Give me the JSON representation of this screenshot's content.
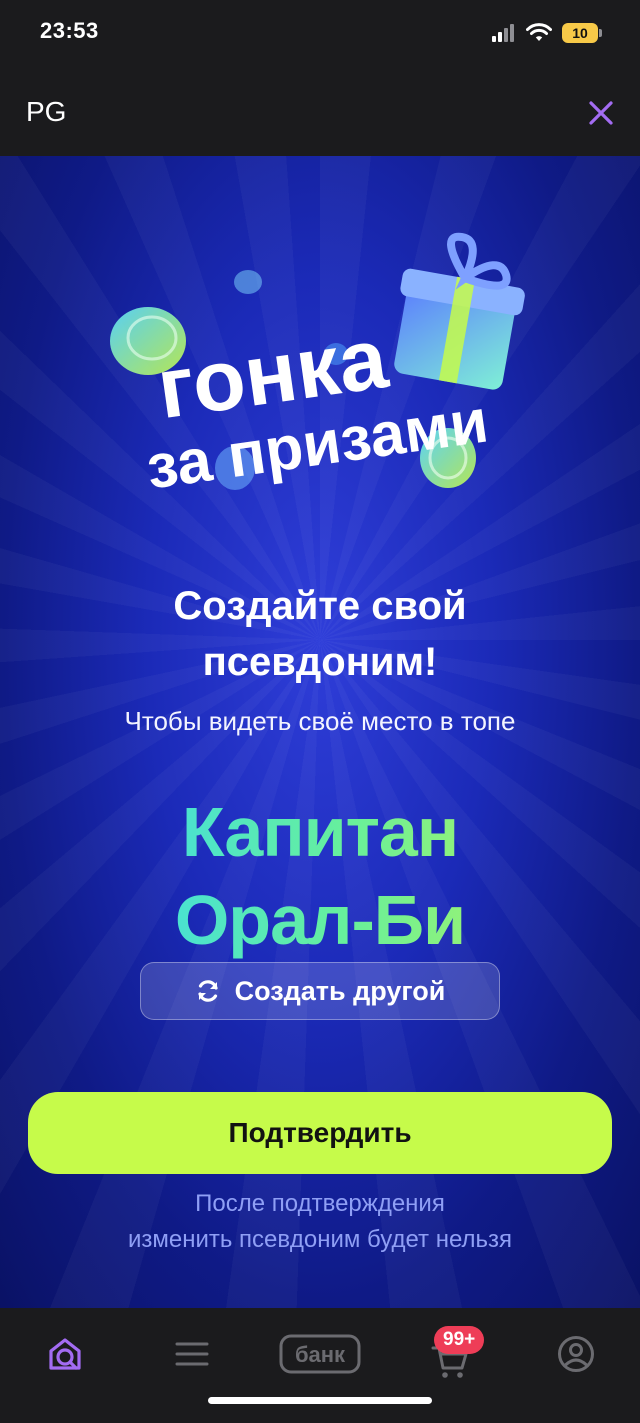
{
  "status_bar": {
    "time": "23:53",
    "battery": "10"
  },
  "header": {
    "title": "PG"
  },
  "banner": {
    "line1": "гонка",
    "line2": "за призами"
  },
  "main": {
    "headline_line1": "Создайте свой",
    "headline_line2": "псевдоним!",
    "subtitle": "Чтобы видеть своё место в топе",
    "nickname_line1": "Капитан",
    "nickname_line2": "Орал-Би",
    "regenerate_label": "Создать другой",
    "confirm_label": "Подтвердить",
    "note_line1": "После подтверждения",
    "note_line2": "изменить псевдоним будет нельзя"
  },
  "bottom_nav": {
    "bank_label": "банк",
    "cart_badge": "99+"
  },
  "colors": {
    "accent_purple": "#a36cf2",
    "confirm_green": "#c6fb4a",
    "promo_blue": "#1b2ab8",
    "badge_red": "#ee3d57"
  }
}
